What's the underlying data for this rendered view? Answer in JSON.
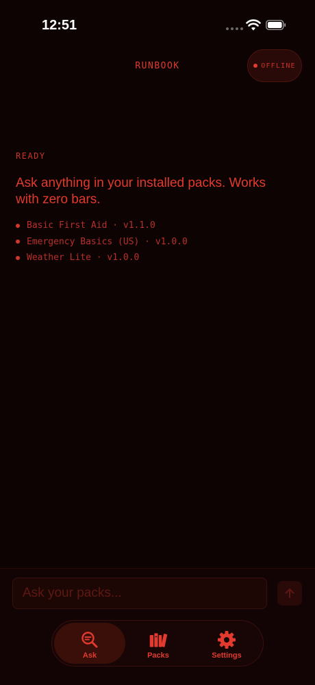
{
  "status_bar": {
    "time": "12:51"
  },
  "header": {
    "title": "RUNBOOK",
    "offline_badge": "OFFLINE"
  },
  "main": {
    "status_label": "READY",
    "intro_text": "Ask anything in your installed packs. Works with zero bars.",
    "installed_packs": [
      "Basic First Aid · v1.1.0",
      "Emergency Basics (US) · v1.0.0",
      "Weather Lite · v1.0.0"
    ]
  },
  "composer": {
    "placeholder": "Ask your packs..."
  },
  "tabs": [
    {
      "label": "Ask",
      "icon": "search-icon",
      "active": true
    },
    {
      "label": "Packs",
      "icon": "books-icon",
      "active": false
    },
    {
      "label": "Settings",
      "icon": "gear-icon",
      "active": false
    }
  ],
  "colors": {
    "accent": "#e23a2e",
    "background": "#0d0303"
  }
}
